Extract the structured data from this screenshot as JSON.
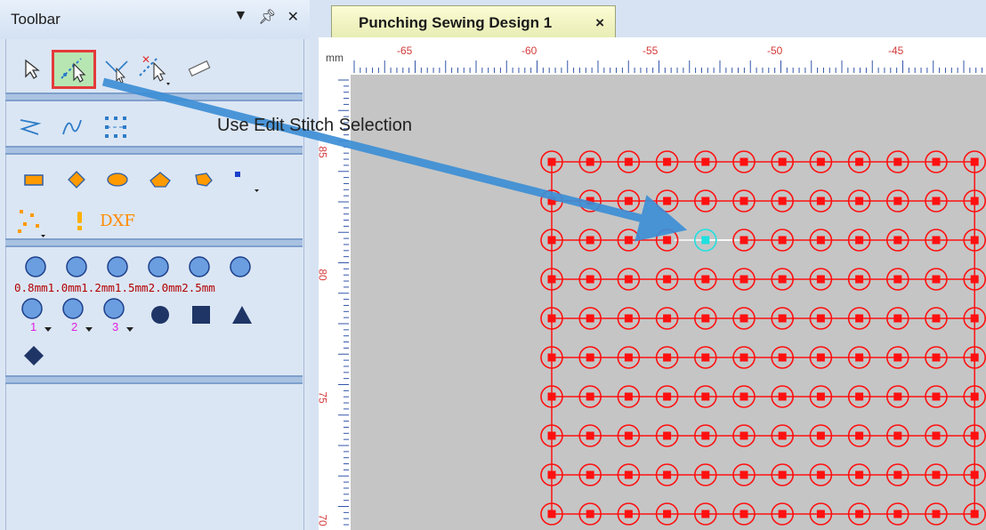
{
  "panel": {
    "title": "Toolbar",
    "controls": {
      "dropdown": "▼",
      "pin": "ᵖ",
      "close": "✕"
    }
  },
  "toolbar": {
    "row1_icons": [
      "pointer-arrow-icon",
      "edit-stitch-selection-icon",
      "stitch-join-icon",
      "stitch-delete-icon",
      "measure-ruler-icon"
    ],
    "row2_icons": [
      "zigzag-stitch-icon",
      "wave-stitch-icon",
      "grid-stitch-icon"
    ],
    "shape_icons": [
      "rectangle-icon",
      "diamond-icon",
      "ellipse-icon",
      "pentagon-icon",
      "polygon-icon",
      "point-dropdown-icon",
      "scatter-points-icon",
      "exclamation-icon",
      "dxf-import-icon"
    ],
    "dxf_label": "DXF",
    "diameter_labels": [
      "0.8mm",
      "1.0mm",
      "1.2mm",
      "1.5mm",
      "2.0mm",
      "2.5mm"
    ],
    "custom_labels": [
      "1",
      "2",
      "3"
    ]
  },
  "document": {
    "tab_label": "Punching Sewing Design 1",
    "tab_close": "×",
    "ruler_unit": "mm",
    "top_ruler_ticks": [
      "-65",
      "-60",
      "-55",
      "-50",
      "-45"
    ],
    "left_ruler_ticks": [
      "85",
      "80",
      "75",
      "70"
    ]
  },
  "annotation": {
    "text": "Use Edit Stitch Selection"
  },
  "colors": {
    "stitch": "#ff1010",
    "selected_stitch": "#20e0e0",
    "canvas": "#c5c5c5",
    "arrow": "#3d8fd6",
    "highlight_box": "#e43a3a"
  },
  "stitch_grid": {
    "rows": 10,
    "columns": 12,
    "selected_row": 3,
    "selected_column": 5
  }
}
